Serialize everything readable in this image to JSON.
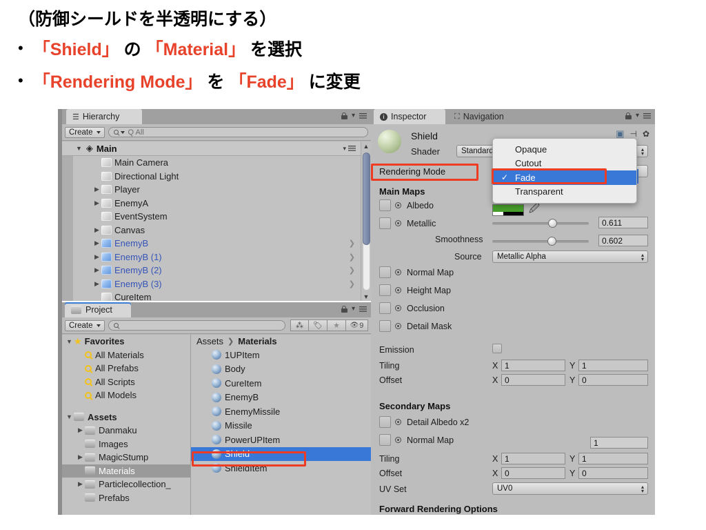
{
  "slide": {
    "title": "（防御シールドを半透明にする）",
    "bullets": [
      {
        "pre": "",
        "a": "「Shield」",
        "mid": " の ",
        "b": "「Material」",
        "post": " を選択"
      },
      {
        "pre": "",
        "a": "「Rendering Mode」",
        "mid": " を ",
        "b": "「Fade」",
        "post": " に変更"
      }
    ],
    "accent_color": "#e8422a",
    "bullet_glyph": "•"
  },
  "hierarchy": {
    "tab_label": "Hierarchy",
    "tab_icon": "hierarchy-icon",
    "create_label": "Create",
    "search_placeholder": "Q All",
    "root": {
      "label": "Main",
      "icon": "unity-logo-icon"
    },
    "items": [
      {
        "label": "Main Camera",
        "indent": 2,
        "expandable": false,
        "prefab": false,
        "chevron": false
      },
      {
        "label": "Directional Light",
        "indent": 2,
        "expandable": false,
        "prefab": false,
        "chevron": false
      },
      {
        "label": "Player",
        "indent": 2,
        "expandable": true,
        "prefab": false,
        "chevron": false
      },
      {
        "label": "EnemyA",
        "indent": 2,
        "expandable": true,
        "prefab": false,
        "chevron": false
      },
      {
        "label": "EventSystem",
        "indent": 2,
        "expandable": false,
        "prefab": false,
        "chevron": false
      },
      {
        "label": "Canvas",
        "indent": 2,
        "expandable": true,
        "prefab": false,
        "chevron": false
      },
      {
        "label": "EnemyB",
        "indent": 2,
        "expandable": true,
        "prefab": true,
        "chevron": true
      },
      {
        "label": "EnemyB (1)",
        "indent": 2,
        "expandable": true,
        "prefab": true,
        "chevron": true
      },
      {
        "label": "EnemyB (2)",
        "indent": 2,
        "expandable": true,
        "prefab": true,
        "chevron": true
      },
      {
        "label": "EnemyB (3)",
        "indent": 2,
        "expandable": true,
        "prefab": true,
        "chevron": true
      },
      {
        "label": "CureItem",
        "indent": 2,
        "expandable": false,
        "prefab": false,
        "chevron": false
      }
    ]
  },
  "project": {
    "tab_label": "Project",
    "tab_icon": "folder-icon",
    "create_label": "Create",
    "search_placeholder": "",
    "toolbar_icons": [
      "asset-bundle-icon",
      "label-tag-icon",
      "favorite-star-icon",
      "hidden-eye-icon"
    ],
    "hidden_count": "9",
    "tree": [
      {
        "label": "Favorites",
        "kind": "star",
        "indent": 0,
        "expandable": true,
        "selected": false
      },
      {
        "label": "All Materials",
        "kind": "search",
        "indent": 1,
        "expandable": false,
        "selected": false
      },
      {
        "label": "All Prefabs",
        "kind": "search",
        "indent": 1,
        "expandable": false,
        "selected": false
      },
      {
        "label": "All Scripts",
        "kind": "search",
        "indent": 1,
        "expandable": false,
        "selected": false
      },
      {
        "label": "All Models",
        "kind": "search",
        "indent": 1,
        "expandable": false,
        "selected": false
      },
      {
        "label": "",
        "kind": "spacer",
        "indent": 0,
        "expandable": false,
        "selected": false
      },
      {
        "label": "Assets",
        "kind": "folder",
        "indent": 0,
        "expandable": true,
        "selected": false
      },
      {
        "label": "Danmaku",
        "kind": "folder",
        "indent": 1,
        "expandable": true,
        "selected": false
      },
      {
        "label": "Images",
        "kind": "folder",
        "indent": 1,
        "expandable": false,
        "selected": false
      },
      {
        "label": "MagicStump",
        "kind": "folder",
        "indent": 1,
        "expandable": true,
        "selected": false
      },
      {
        "label": "Materials",
        "kind": "folder",
        "indent": 1,
        "expandable": false,
        "selected": true
      },
      {
        "label": "Particlecollection_",
        "kind": "folder",
        "indent": 1,
        "expandable": true,
        "selected": false
      },
      {
        "label": "Prefabs",
        "kind": "folder",
        "indent": 1,
        "expandable": false,
        "selected": false
      }
    ],
    "breadcrumb": [
      "Assets",
      "Materials"
    ],
    "assets": [
      {
        "label": "1UPItem",
        "selected": false
      },
      {
        "label": "Body",
        "selected": false
      },
      {
        "label": "CureItem",
        "selected": false
      },
      {
        "label": "EnemyB",
        "selected": false
      },
      {
        "label": "EnemyMissile",
        "selected": false
      },
      {
        "label": "Missile",
        "selected": false
      },
      {
        "label": "PowerUPItem",
        "selected": false
      },
      {
        "label": "Shield",
        "selected": true
      },
      {
        "label": "ShieldItem",
        "selected": false
      }
    ]
  },
  "inspector": {
    "tabs": [
      {
        "label": "Inspector",
        "icon": "info-icon",
        "active": true
      },
      {
        "label": "Navigation",
        "icon": "navigation-icon",
        "active": false
      }
    ],
    "material_name": "Shield",
    "shader_label": "Shader",
    "shader_value": "Standard",
    "rendering_mode_label": "Rendering Mode",
    "rendering_mode_options": [
      "Opaque",
      "Cutout",
      "Fade",
      "Transparent"
    ],
    "rendering_mode_selected": "Fade",
    "check_glyph": "✓",
    "main_maps_header": "Main Maps",
    "main_maps": [
      {
        "label": "Albedo",
        "checkbox": true,
        "radio": true
      },
      {
        "label": "Metallic",
        "checkbox": true,
        "radio": true
      },
      {
        "label": "Normal Map",
        "checkbox": true,
        "radio": true
      },
      {
        "label": "Height Map",
        "checkbox": true,
        "radio": true
      },
      {
        "label": "Occlusion",
        "checkbox": true,
        "radio": true
      },
      {
        "label": "Detail Mask",
        "checkbox": true,
        "radio": true
      }
    ],
    "albedo_color": "#47a02c",
    "eyedropper_icon": "eyedropper-icon",
    "metallic_value": "0.611",
    "metallic_pct": 61,
    "smoothness_label": "Smoothness",
    "smoothness_value": "0.602",
    "smoothness_pct": 60,
    "source_label": "Source",
    "source_value": "Metallic Alpha",
    "emission_label": "Emission",
    "tiling_label": "Tiling",
    "offset_label": "Offset",
    "axis_x": "X",
    "axis_y": "Y",
    "main_tiling": {
      "x": "1",
      "y": "1"
    },
    "main_offset": {
      "x": "0",
      "y": "0"
    },
    "secondary_maps_header": "Secondary Maps",
    "secondary_maps": [
      {
        "label": "Detail Albedo x2",
        "value": ""
      },
      {
        "label": "Normal Map",
        "value": "1"
      }
    ],
    "secondary_tiling": {
      "x": "1",
      "y": "1"
    },
    "secondary_offset": {
      "x": "0",
      "y": "0"
    },
    "uv_set_label": "UV Set",
    "uv_set_value": "UV0",
    "forward_rendering_header": "Forward Rendering Options",
    "header_icons": [
      "preset-icon",
      "layout-icon",
      "settings-gear-icon"
    ]
  },
  "annotations": {
    "highlight_color": "#ee3b24",
    "boxes": [
      "rendering-mode-label",
      "fade-menu-item",
      "shield-asset-row"
    ]
  }
}
